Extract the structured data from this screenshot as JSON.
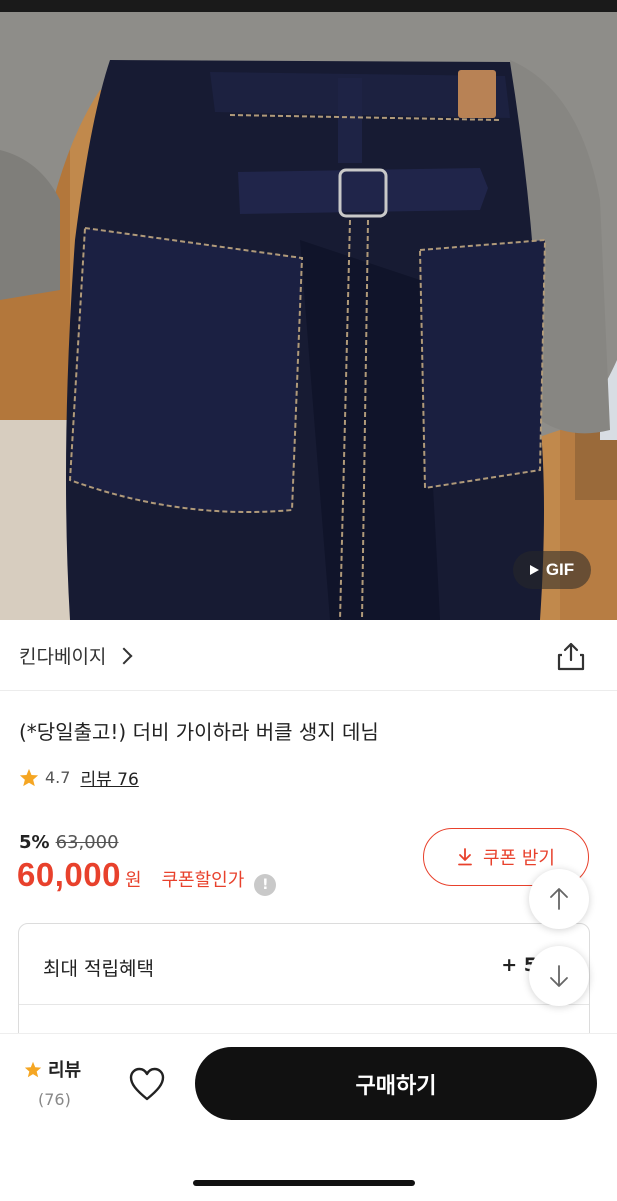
{
  "hero": {
    "badge_label": "GIF",
    "badge_icon": "play-icon"
  },
  "brand": {
    "name": "킨다베이지"
  },
  "product": {
    "title": "(*당일출고!) 더비 가이하라 버클 생지 데님",
    "rating": "4.7",
    "review_label": "리뷰 76",
    "discount_rate": "5%",
    "original_price": "63,000",
    "price": "60,000",
    "price_unit": "원",
    "coupon_price_label": "쿠폰할인가"
  },
  "coupon": {
    "button_label": "쿠폰 받기"
  },
  "benefit": {
    "title": "최대 적립혜택",
    "amount": "+ 5"
  },
  "bottom": {
    "review_label": "리뷰",
    "review_count": "(76)",
    "buy_label": "구매하기"
  },
  "colors": {
    "accent": "#e8412c",
    "buy_button": "#111111",
    "star": "#f5a623"
  }
}
